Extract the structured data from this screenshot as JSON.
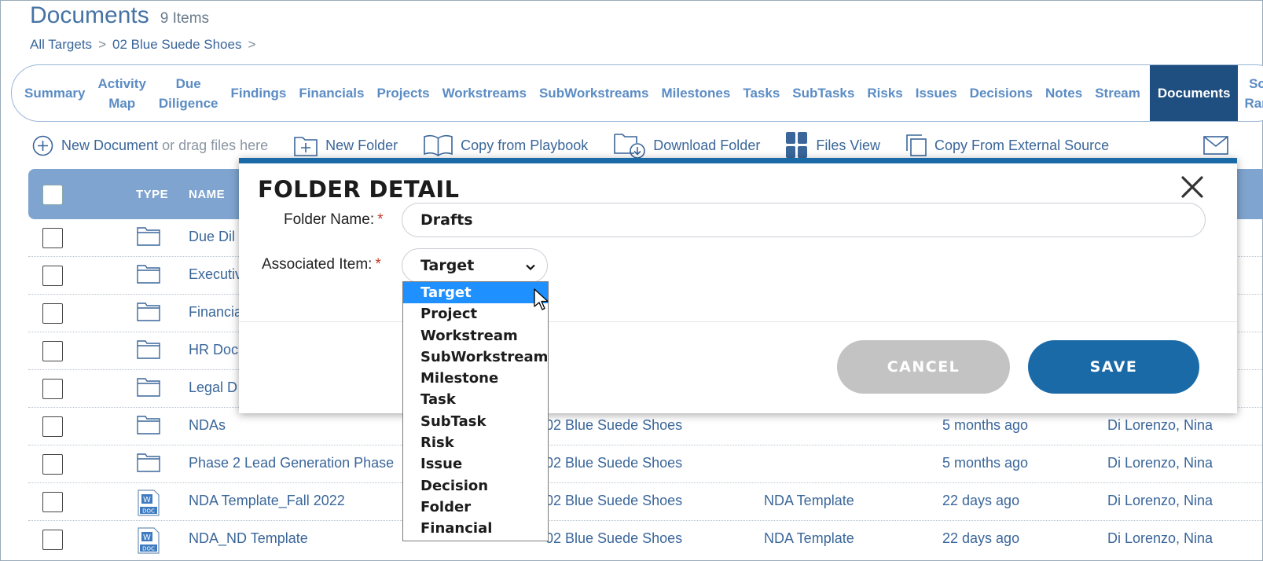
{
  "page": {
    "title": "Documents",
    "count": "9 Items"
  },
  "breadcrumb": {
    "items": [
      "All Targets",
      "02 Blue Suede Shoes"
    ],
    "sep": ">"
  },
  "tabs": [
    {
      "l1": "Summary",
      "l2": ""
    },
    {
      "l1": "Activity",
      "l2": "Map"
    },
    {
      "l1": "Due",
      "l2": "Diligence"
    },
    {
      "l1": "Findings",
      "l2": ""
    },
    {
      "l1": "Financials",
      "l2": ""
    },
    {
      "l1": "Projects",
      "l2": ""
    },
    {
      "l1": "Workstreams",
      "l2": ""
    },
    {
      "l1": "SubWorkstreams",
      "l2": ""
    },
    {
      "l1": "Milestones",
      "l2": ""
    },
    {
      "l1": "Tasks",
      "l2": ""
    },
    {
      "l1": "SubTasks",
      "l2": ""
    },
    {
      "l1": "Risks",
      "l2": ""
    },
    {
      "l1": "Issues",
      "l2": ""
    },
    {
      "l1": "Decisions",
      "l2": ""
    },
    {
      "l1": "Notes",
      "l2": ""
    },
    {
      "l1": "Stream",
      "l2": ""
    },
    {
      "l1": "Documents",
      "l2": ""
    },
    {
      "l1": "Sc",
      "l2": "Ran"
    }
  ],
  "toolbar": {
    "new_document": "New Document",
    "drag_hint": "or drag files here",
    "new_folder": "New Folder",
    "copy_playbook": "Copy from Playbook",
    "download_folder": "Download Folder",
    "files_view": "Files View",
    "copy_external": "Copy From External Source"
  },
  "table": {
    "headers": {
      "type": "TYPE",
      "name": "NAME"
    },
    "rows": [
      {
        "type": "folder-icon",
        "name": "Due Dil",
        "target": "",
        "template": "",
        "modified": "",
        "owner": ""
      },
      {
        "type": "folder-icon",
        "name": "Executiv",
        "target": "",
        "template": "",
        "modified": "",
        "owner": ""
      },
      {
        "type": "folder-icon",
        "name": "Financia",
        "target": "",
        "template": "",
        "modified": "",
        "owner": ""
      },
      {
        "type": "folder-icon",
        "name": "HR Doc",
        "target": "",
        "template": "",
        "modified": "",
        "owner": ""
      },
      {
        "type": "folder-icon",
        "name": "Legal D",
        "target": "",
        "template": "",
        "modified": "",
        "owner": ""
      },
      {
        "type": "folder-icon",
        "name": "NDAs",
        "target": "02 Blue Suede Shoes",
        "template": "",
        "modified": "5 months ago",
        "owner": "Di Lorenzo, Nina"
      },
      {
        "type": "folder-icon",
        "name": "Phase 2 Lead Generation Phase",
        "target": "02 Blue Suede Shoes",
        "template": "",
        "modified": "5 months ago",
        "owner": "Di Lorenzo, Nina"
      },
      {
        "type": "word-doc-icon",
        "name": "NDA Template_Fall 2022",
        "target": "02 Blue Suede Shoes",
        "template": "NDA Template",
        "modified": "22 days ago",
        "owner": "Di Lorenzo, Nina"
      },
      {
        "type": "word-doc-icon",
        "name": "NDA_ND Template",
        "target": "02 Blue Suede Shoes",
        "template": "NDA Template",
        "modified": "22 days ago",
        "owner": "Di Lorenzo, Nina"
      }
    ]
  },
  "modal": {
    "title": "FOLDER DETAIL",
    "folder_name_label": "Folder Name:",
    "folder_name_value": "Drafts",
    "associated_label": "Associated Item:",
    "associated_value": "Target",
    "required_mark": "*",
    "cancel_label": "CANCEL",
    "save_label": "SAVE",
    "options": [
      "Target",
      "Project",
      "Workstream",
      "SubWorkstream",
      "Milestone",
      "Task",
      "SubTask",
      "Risk",
      "Issue",
      "Decision",
      "Folder",
      "Financial"
    ],
    "selected_option": "Target"
  },
  "colors": {
    "accent": "#1b6aa8",
    "tab_active": "#1f4e80",
    "header_bg": "#7fa4cf",
    "option_highlight": "#1e90ff"
  }
}
